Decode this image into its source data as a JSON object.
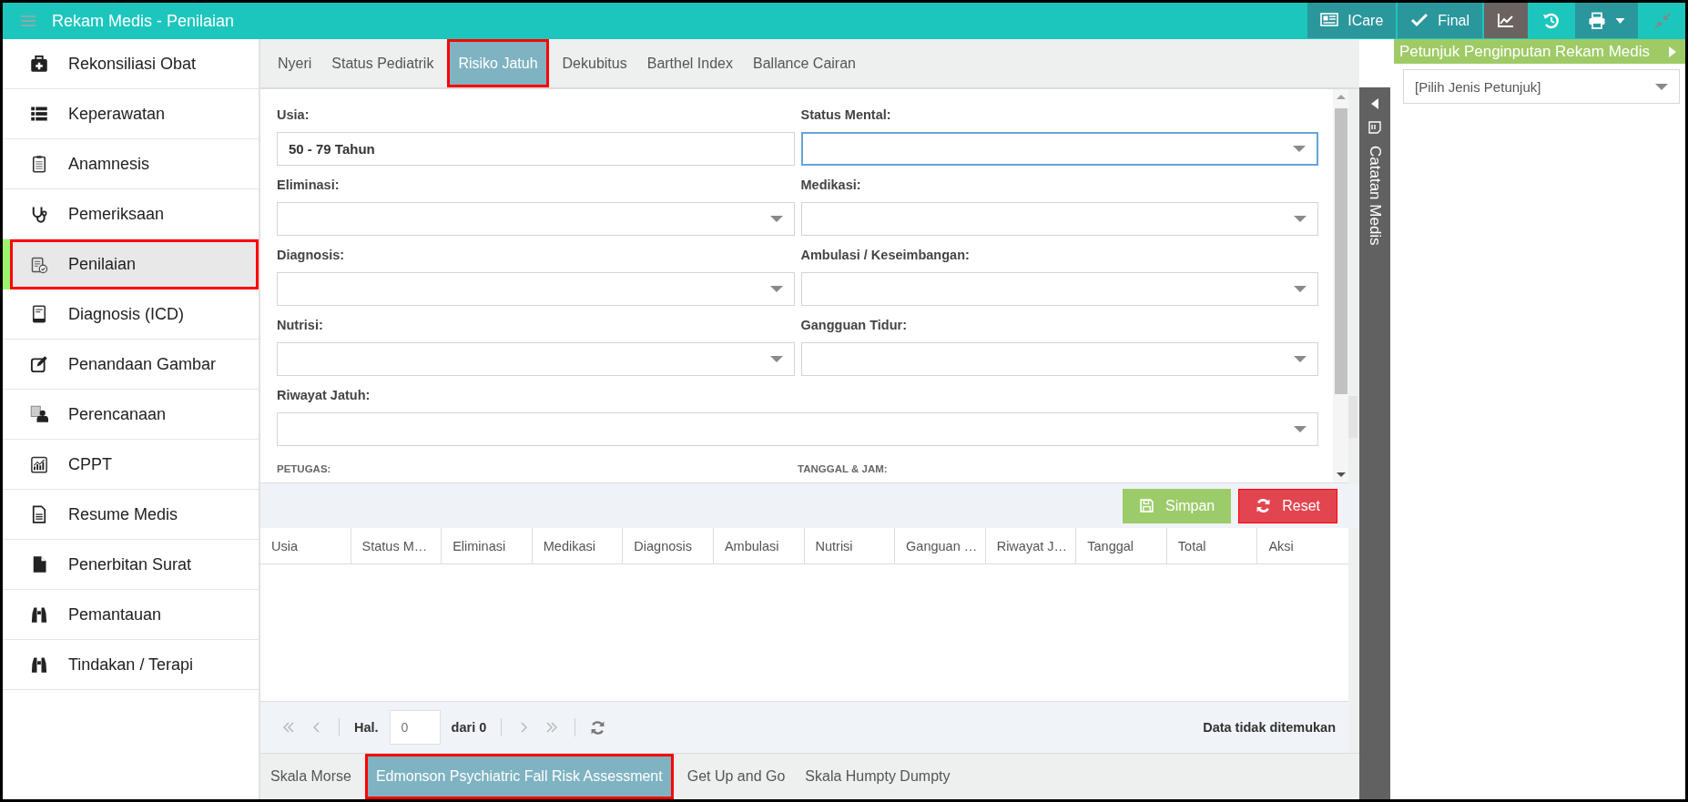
{
  "window": {
    "title": "Rekam Medis - Penilaian"
  },
  "toolbar": {
    "buttons": [
      {
        "kind": "icare",
        "label": "ICare"
      },
      {
        "kind": "final",
        "label": "Final"
      },
      {
        "kind": "chart"
      },
      {
        "kind": "history"
      },
      {
        "kind": "print"
      },
      {
        "kind": "compress"
      }
    ]
  },
  "sidebar": {
    "items": [
      {
        "label": "Rekonsiliasi Obat",
        "selected": false
      },
      {
        "label": "Keperawatan",
        "selected": false
      },
      {
        "label": "Anamnesis",
        "selected": false
      },
      {
        "label": "Pemeriksaan",
        "selected": false
      },
      {
        "label": "Penilaian",
        "selected": true
      },
      {
        "label": "Diagnosis (ICD)",
        "selected": false
      },
      {
        "label": "Penandaan Gambar",
        "selected": false
      },
      {
        "label": "Perencanaan",
        "selected": false
      },
      {
        "label": "CPPT",
        "selected": false
      },
      {
        "label": "Resume Medis",
        "selected": false
      },
      {
        "label": "Penerbitan Surat",
        "selected": false
      },
      {
        "label": "Pemantauan",
        "selected": false
      },
      {
        "label": "Tindakan / Terapi",
        "selected": false
      }
    ]
  },
  "tabs": [
    {
      "label": "Nyeri",
      "selected": false
    },
    {
      "label": "Status Pediatrik",
      "selected": false
    },
    {
      "label": "Risiko Jatuh",
      "selected": true
    },
    {
      "label": "Dekubitus",
      "selected": false
    },
    {
      "label": "Barthel Index",
      "selected": false
    },
    {
      "label": "Ballance Cairan",
      "selected": false
    }
  ],
  "form": {
    "rows": [
      {
        "fields": [
          {
            "label": "Usia:",
            "kind": "text",
            "value": "50 - 79 Tahun",
            "focused": false
          },
          {
            "label": "Status Mental:",
            "kind": "select",
            "focused": true
          }
        ]
      },
      {
        "fields": [
          {
            "label": "Eliminasi:",
            "kind": "select",
            "focused": false
          },
          {
            "label": "Medikasi:",
            "kind": "select",
            "focused": false
          }
        ]
      },
      {
        "fields": [
          {
            "label": "Diagnosis:",
            "kind": "select",
            "focused": false
          },
          {
            "label": "Ambulasi / Keseimbangan:",
            "kind": "select",
            "focused": false
          }
        ]
      },
      {
        "fields": [
          {
            "label": "Nutrisi:",
            "kind": "select",
            "focused": false
          },
          {
            "label": "Gangguan Tidur:",
            "kind": "select",
            "focused": false
          }
        ]
      },
      {
        "fields": [
          {
            "label": "Riwayat Jatuh:",
            "kind": "select",
            "focused": false
          }
        ]
      }
    ],
    "footer_labels": [
      "PETUGAS:",
      "TANGGAL & JAM:"
    ]
  },
  "actions": [
    {
      "kind": "save",
      "label": "Simpan"
    },
    {
      "kind": "reset",
      "label": "Reset"
    }
  ],
  "table": {
    "columns": [
      "Usia",
      "Status M…",
      "Eliminasi",
      "Medikasi",
      "Diagnosis",
      "Ambulasi",
      "Nutrisi",
      "Ganguan …",
      "Riwayat J…",
      "Tanggal",
      "Total",
      "Aksi"
    ]
  },
  "pager": {
    "page_label": "Hal.",
    "page_placeholder": "0",
    "of_label": "dari 0",
    "status": "Data tidak ditemukan"
  },
  "bottom_tabs": [
    {
      "label": "Skala Morse",
      "selected": false
    },
    {
      "label": "Edmonson Psychiatric Fall Risk Assessment",
      "selected": true
    },
    {
      "label": "Get Up and Go",
      "selected": false
    },
    {
      "label": "Skala Humpty Dumpty",
      "selected": false
    }
  ],
  "side_strip": {
    "title": "Catatan Medis"
  },
  "guide_panel": {
    "title": "Petunjuk Penginputan Rekam Medis",
    "select_value": "[Pilih Jenis Petunjuk]"
  }
}
